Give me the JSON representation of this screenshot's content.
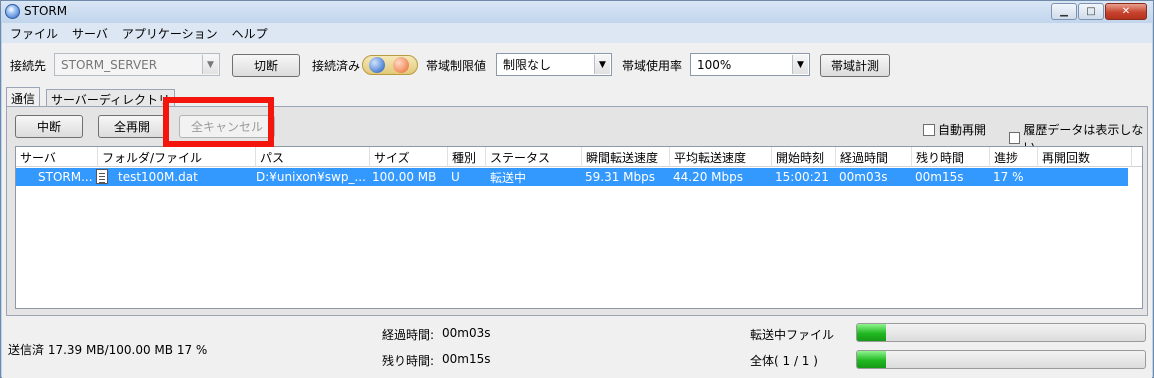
{
  "window": {
    "title": "STORM"
  },
  "menu": [
    "ファイル",
    "サーバ",
    "アプリケーション",
    "ヘルプ"
  ],
  "connection": {
    "label": "接続先",
    "server_value": "STORM_SERVER",
    "disconnect_label": "切断",
    "status_label": "接続済み",
    "bandwidth_limit_label": "帯域制限値",
    "bandwidth_limit_value": "制限なし",
    "bandwidth_usage_label": "帯域使用率",
    "bandwidth_usage_value": "100%",
    "measure_label": "帯域計測"
  },
  "tabs": [
    "通信",
    "サーバーディレクトリ"
  ],
  "controls": {
    "pause_label": "中断",
    "resume_all_label": "全再開",
    "cancel_all_label": "全キャンセル",
    "auto_resume_label": "自動再開",
    "hide_history_label": "履歴データは表示しない"
  },
  "table": {
    "columns": [
      "サーバ",
      "フォルダ/ファイル",
      "パス",
      "サイズ",
      "種別",
      "ステータス",
      "瞬間転送速度",
      "平均転送速度",
      "開始時刻",
      "経過時間",
      "残り時間",
      "進捗",
      "再開回数"
    ],
    "rows": [
      {
        "server": "STORM...",
        "file": "test100M.dat",
        "path": "D:¥unixon¥swp_...",
        "size": "100.00 MB",
        "type": "U",
        "status": "転送中",
        "instant_speed": "59.31 Mbps",
        "avg_speed": "44.20 Mbps",
        "start_time": "15:00:21",
        "elapsed": "00m03s",
        "remaining": "00m15s",
        "progress": "17 %",
        "restarts": ""
      }
    ]
  },
  "status": {
    "sent_text": "送信済  17.39 MB/100.00 MB 17 %",
    "elapsed_label": "経過時間:",
    "elapsed_value": "00m03s",
    "remaining_label": "残り時間:",
    "remaining_value": "00m15s",
    "transferring_label": "転送中ファイル",
    "total_label": "全体( 1 / 1 )",
    "file_progress": 0.1,
    "total_progress": 0.1
  }
}
